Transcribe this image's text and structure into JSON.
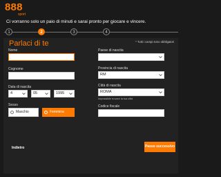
{
  "brand": {
    "logo_number": "888",
    "logo_sub": "sport"
  },
  "intro_text": "Ci vorranno solo un paio di minuti e sarai pronto per giocare e vincere.",
  "steps": [
    "1",
    "2",
    "3",
    "4"
  ],
  "active_step": 2,
  "form": {
    "title": "Parlaci di te",
    "required_note": "* Tutti i campi sono obbligatori",
    "nome_label": "Nome",
    "nome_value": "",
    "cognome_label": "Cognome",
    "cognome_value": "",
    "dob_label": "Data di nascita",
    "dob_day": "4",
    "dob_month": "05",
    "dob_year": "1995",
    "sesso_label": "Sesso",
    "gender_male": "Maschio",
    "gender_female": "Femmina",
    "gender_selected": "Femmina",
    "paese_label": "Paese di nascita",
    "paese_value": "",
    "provincia_label": "Provincia di nascita",
    "provincia_value": "RM",
    "citta_label": "Città di nascita",
    "citta_value": "ROMA",
    "citta_hint": "Impossibile trovare la tua città",
    "codice_label": "Codice fiscale",
    "codice_value": ""
  },
  "nav": {
    "back_label": "Indietro",
    "next_label": "Passo successivo"
  },
  "colors": {
    "accent": "#ff7a00",
    "background": "#1a1a1a",
    "panel": "#222222"
  }
}
